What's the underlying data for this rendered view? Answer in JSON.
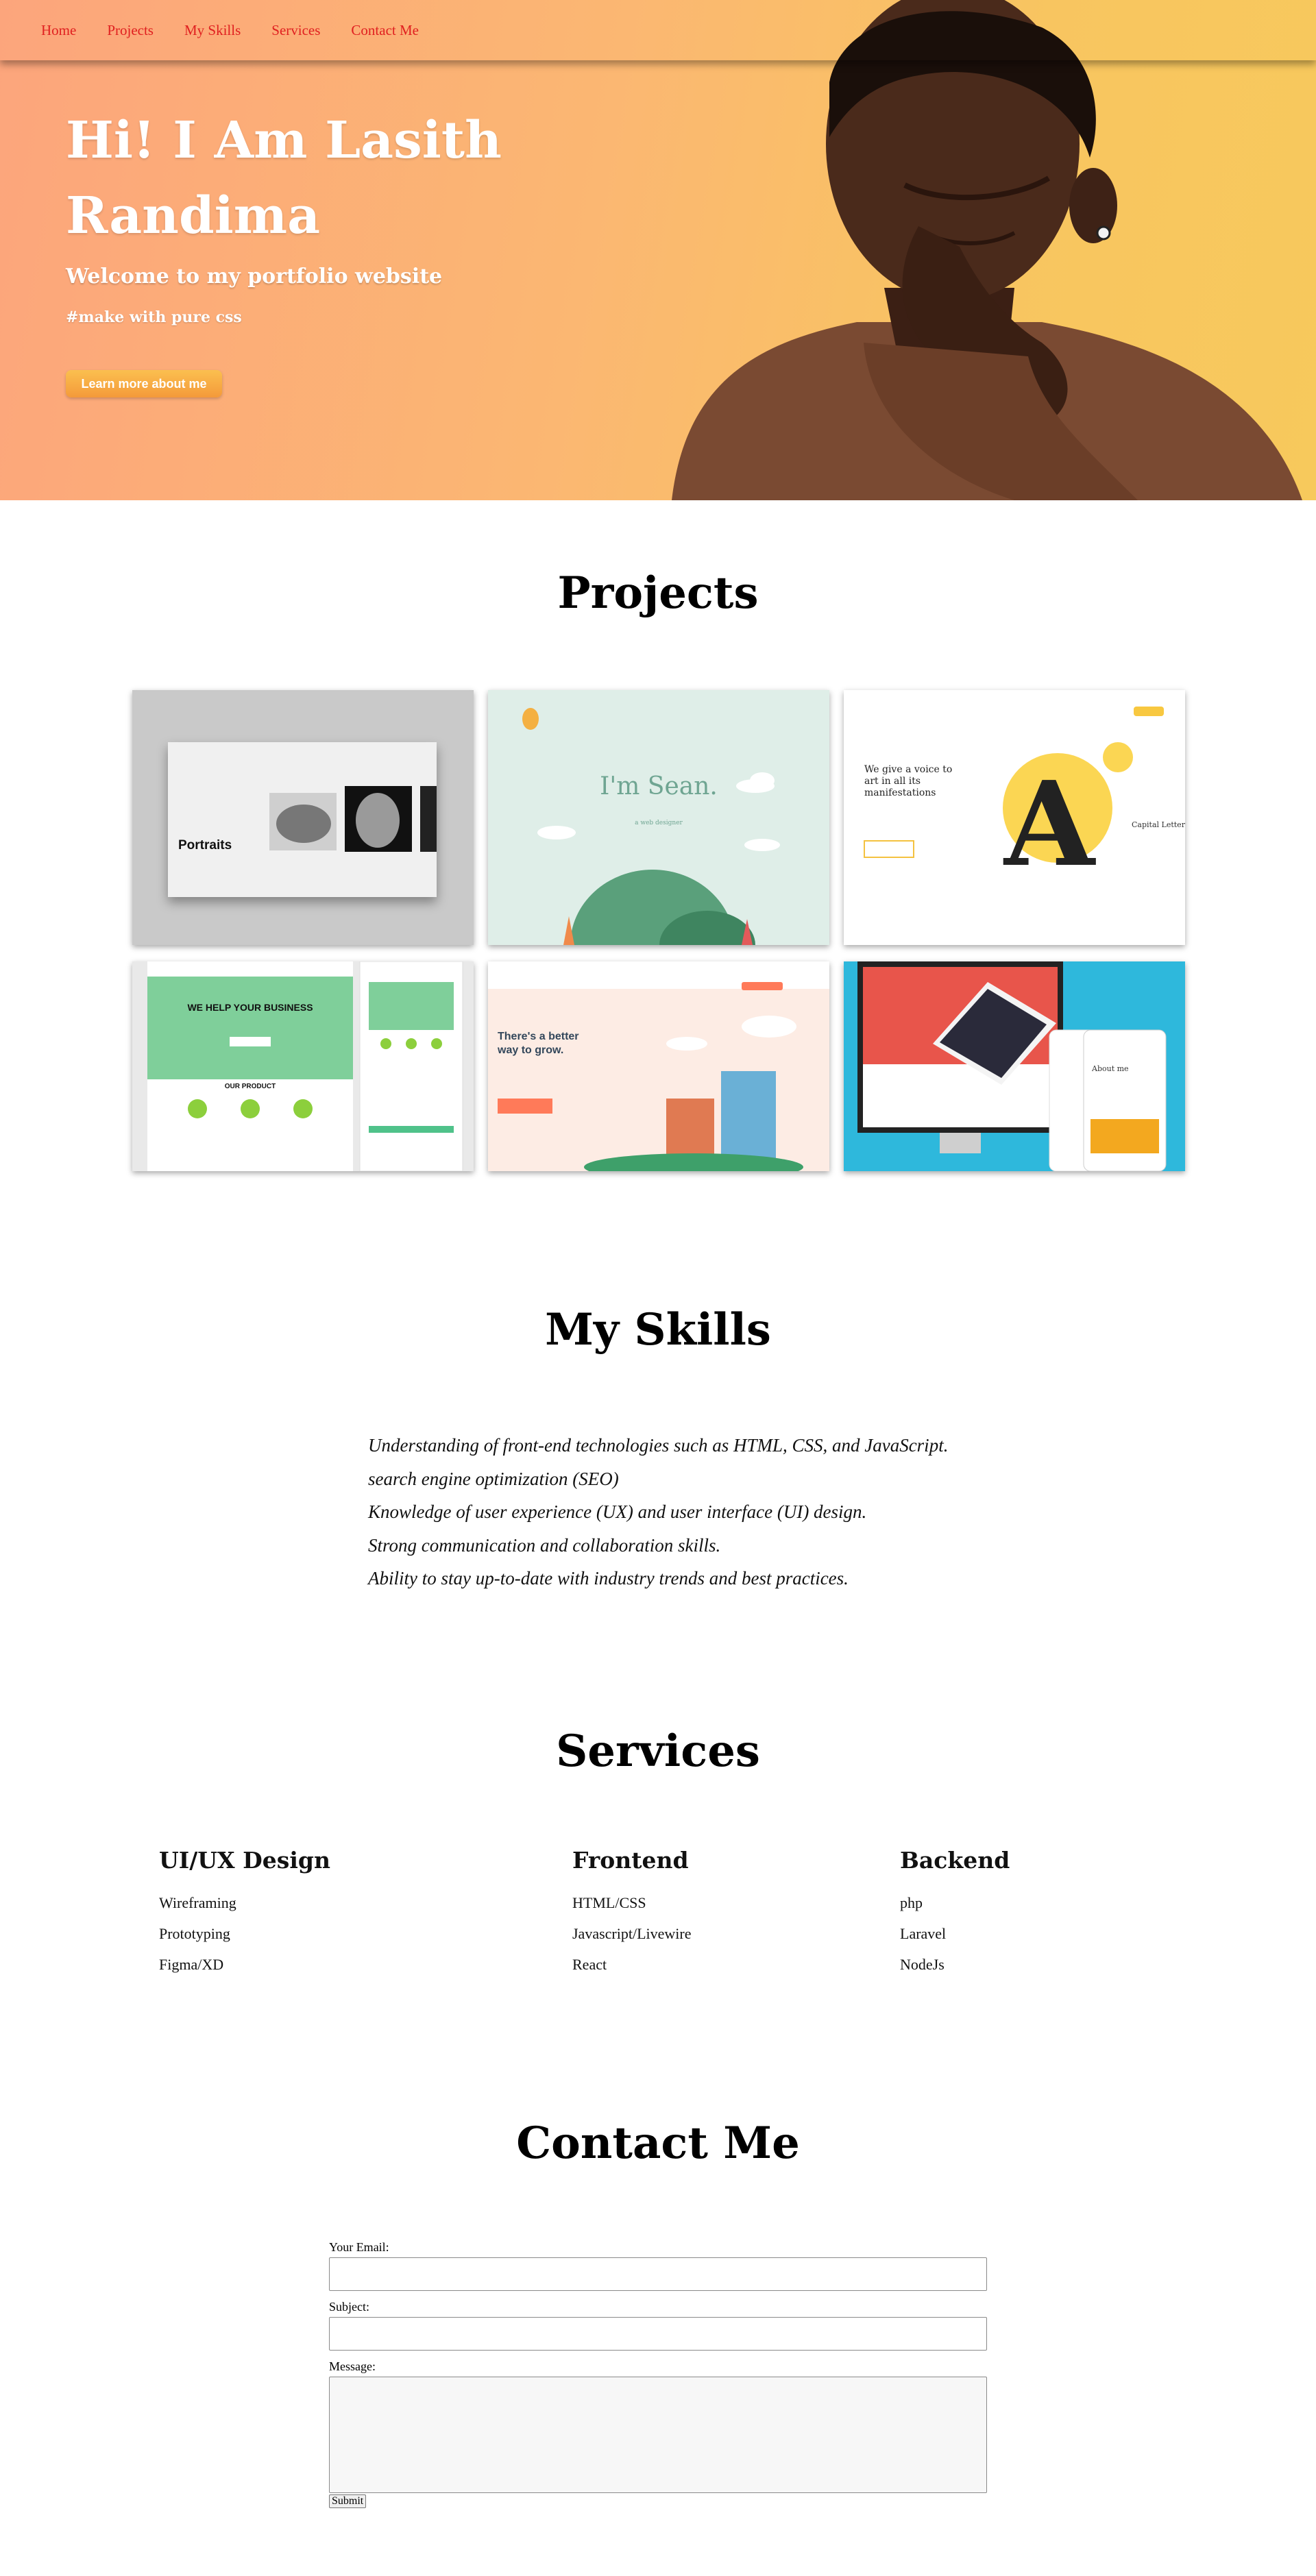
{
  "nav": {
    "items": [
      "Home",
      "Projects",
      "My Skills",
      "Services",
      "Contact Me"
    ]
  },
  "hero": {
    "title": "Hi! I Am Lasith Randima",
    "subtitle": "Welcome to my portfolio website",
    "tag": "#make with pure css",
    "button": "Learn more about me"
  },
  "projects": {
    "title": "Projects",
    "thumbs": [
      {
        "name": "portraits",
        "caption": "Portraits"
      },
      {
        "name": "sean",
        "caption": "I'm Sean.",
        "sub": "a web designer"
      },
      {
        "name": "capital-letters",
        "caption": "We give a voice to art in all its manifestations",
        "side": "Capital Letters"
      },
      {
        "name": "business",
        "caption": "WE HELP YOUR BUSINESS",
        "sub": "OUR PRODUCT"
      },
      {
        "name": "hubspot",
        "caption": "There's a better way to grow."
      },
      {
        "name": "devices",
        "caption": "About me"
      }
    ]
  },
  "skills": {
    "title": "My Skills",
    "items": [
      "Understanding of front-end technologies such as HTML, CSS, and JavaScript.",
      "search engine optimization (SEO)",
      "Knowledge of user experience (UX) and user interface (UI) design.",
      "Strong communication and collaboration skills.",
      "Ability to stay up-to-date with industry trends and best practices."
    ]
  },
  "services": {
    "title": "Services",
    "columns": [
      {
        "heading": "UI/UX Design",
        "items": [
          "Wireframing",
          "Prototyping",
          "Figma/XD"
        ]
      },
      {
        "heading": "Frontend",
        "items": [
          "HTML/CSS",
          "Javascript/Livewire",
          "React"
        ]
      },
      {
        "heading": "Backend",
        "items": [
          "php",
          "Laravel",
          "NodeJs"
        ]
      }
    ]
  },
  "contact": {
    "title": "Contact Me",
    "email_label": "Your Email:",
    "subject_label": "Subject:",
    "message_label": "Message:",
    "submit": "Submit"
  },
  "colors": {
    "nav_link": "#e02020",
    "hero_start": "#fca57c",
    "hero_end": "#f7c95c",
    "button": "#f7a640"
  }
}
